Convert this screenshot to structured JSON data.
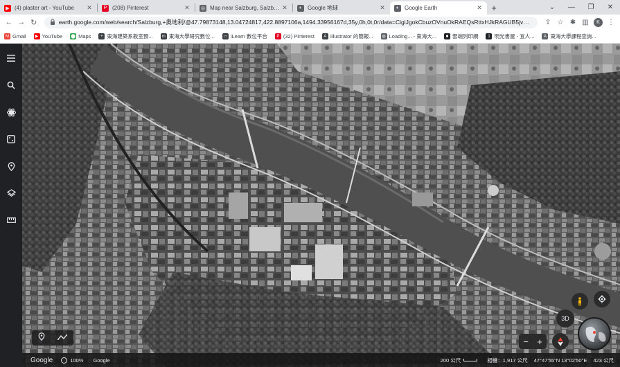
{
  "browser": {
    "tabs": [
      {
        "label": "(4) plaster art - YouTube",
        "close": "✕",
        "icon": "youtube-icon",
        "color": "#ff0000",
        "glyph": "▶"
      },
      {
        "label": "(208) Pinterest",
        "close": "✕",
        "icon": "pinterest-icon",
        "color": "#e60023",
        "glyph": "P"
      },
      {
        "label": "Map near Salzburg, Salzburg, A",
        "close": "✕",
        "icon": "maps-icon",
        "color": "#5f6368",
        "glyph": "◎"
      },
      {
        "label": "Google 地球",
        "close": "✕",
        "icon": "google-earth-icon",
        "color": "#5f6368",
        "glyph": "◐"
      },
      {
        "label": "Google Earth",
        "close": "✕",
        "icon": "google-earth-icon",
        "color": "#5f6368",
        "glyph": "◐",
        "active": true
      }
    ],
    "new_tab": "+",
    "window_controls": {
      "collapse": "⌄",
      "minimize": "—",
      "maximize": "❐",
      "close": "✕"
    },
    "nav": {
      "back": "←",
      "forward": "→",
      "reload": "↻"
    },
    "url": "earth.google.com/web/search/Salzburg,+奧地利/@47.79873148,13.04724817,422.8897106a,1494.33956167d,35y,0h,0t,0r/data=CigiJgokCbuzOVnuOkRAEQsRttxHJkRAGUB5jvmI...",
    "toolbar_icons": {
      "share": "⇪",
      "bookmark": "☆",
      "extensions": "✱",
      "reading_list": "▥",
      "menu": "⋮"
    },
    "profile_initial": "K",
    "bookmarks": [
      {
        "label": "Gmail",
        "icon": "gmail-icon",
        "color": "#ea4335",
        "glyph": "M"
      },
      {
        "label": "YouTube",
        "icon": "youtube-icon",
        "color": "#ff0000",
        "glyph": "▶"
      },
      {
        "label": "Maps",
        "icon": "maps-pin-icon",
        "color": "#34a853",
        "glyph": "⬤"
      },
      {
        "label": "東海建築系教室預...",
        "icon": "bookmark-site-icon",
        "color": "#3c4043",
        "glyph": "+"
      },
      {
        "label": "東海大學研究數位...",
        "icon": "bookmark-site-icon",
        "color": "#3c4043",
        "glyph": "m"
      },
      {
        "label": "iLearn 數位平台",
        "icon": "ilearn-icon",
        "color": "#3c4043",
        "glyph": "▭"
      },
      {
        "label": "(32) Pinterest",
        "icon": "pinterest-icon",
        "color": "#e60023",
        "glyph": "P"
      },
      {
        "label": "Illustrator 的簡報...",
        "icon": "adobe-icon",
        "color": "#3c4043",
        "glyph": "A"
      },
      {
        "label": "Loading... - 東海大...",
        "icon": "globe-icon",
        "color": "#5f6368",
        "glyph": "◍"
      },
      {
        "label": "雲端列印網",
        "icon": "print-icon",
        "color": "#202124",
        "glyph": "■"
      },
      {
        "label": "明光書屋 - 宜人...",
        "icon": "bookmark-site-icon",
        "color": "#202124",
        "glyph": "1"
      },
      {
        "label": "東海大學課程查詢...",
        "icon": "bookmark-site-icon",
        "color": "#5f6368",
        "glyph": "A"
      }
    ]
  },
  "earth": {
    "status": {
      "brand": "Google",
      "loading": "100%",
      "attribution": "Google",
      "scale": "200 公尺",
      "camera": "相機：1,917 公尺",
      "coords": "47°47'55\"N 13°02'50\"E",
      "altitude": "423 公尺"
    },
    "view_mode": "3D",
    "zoom": {
      "out": "−",
      "in": "+"
    },
    "buttons": {
      "voyager_hint": "♦"
    }
  }
}
